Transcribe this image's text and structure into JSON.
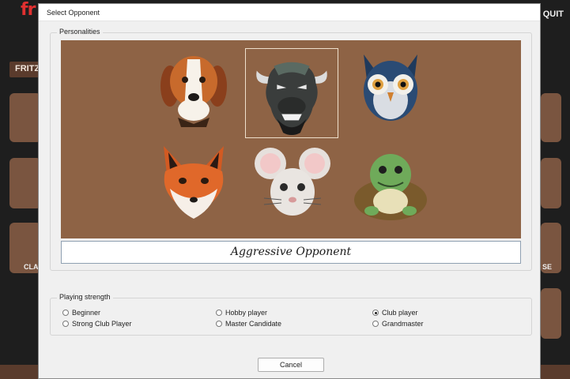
{
  "background": {
    "logo": "fr",
    "quit_label": "QUIT",
    "tab_label": "FRITZ",
    "left_tile_label": "CLA",
    "right_tile_label": "SE"
  },
  "dialog": {
    "title": "Select Opponent",
    "personalities_label": "Personalities",
    "opponents": [
      {
        "animal": "beagle",
        "icon": "beagle-face-icon",
        "selected": false
      },
      {
        "animal": "bull",
        "icon": "bull-face-icon",
        "selected": true
      },
      {
        "animal": "owl",
        "icon": "owl-face-icon",
        "selected": false
      },
      {
        "animal": "fox",
        "icon": "fox-face-icon",
        "selected": false
      },
      {
        "animal": "mouse",
        "icon": "mouse-face-icon",
        "selected": false
      },
      {
        "animal": "turtle",
        "icon": "turtle-face-icon",
        "selected": false
      }
    ],
    "description": "Aggressive Opponent",
    "strength_label": "Playing strength",
    "strengths": [
      {
        "label": "Beginner",
        "checked": false
      },
      {
        "label": "Hobby player",
        "checked": false
      },
      {
        "label": "Club player",
        "checked": true
      },
      {
        "label": "Strong Club Player",
        "checked": false
      },
      {
        "label": "Master Candidate",
        "checked": false
      },
      {
        "label": "Grandmaster",
        "checked": false
      }
    ],
    "cancel_label": "Cancel"
  },
  "colors": {
    "grid_background": "#8e6345",
    "dialog_background": "#f0f0f0"
  }
}
